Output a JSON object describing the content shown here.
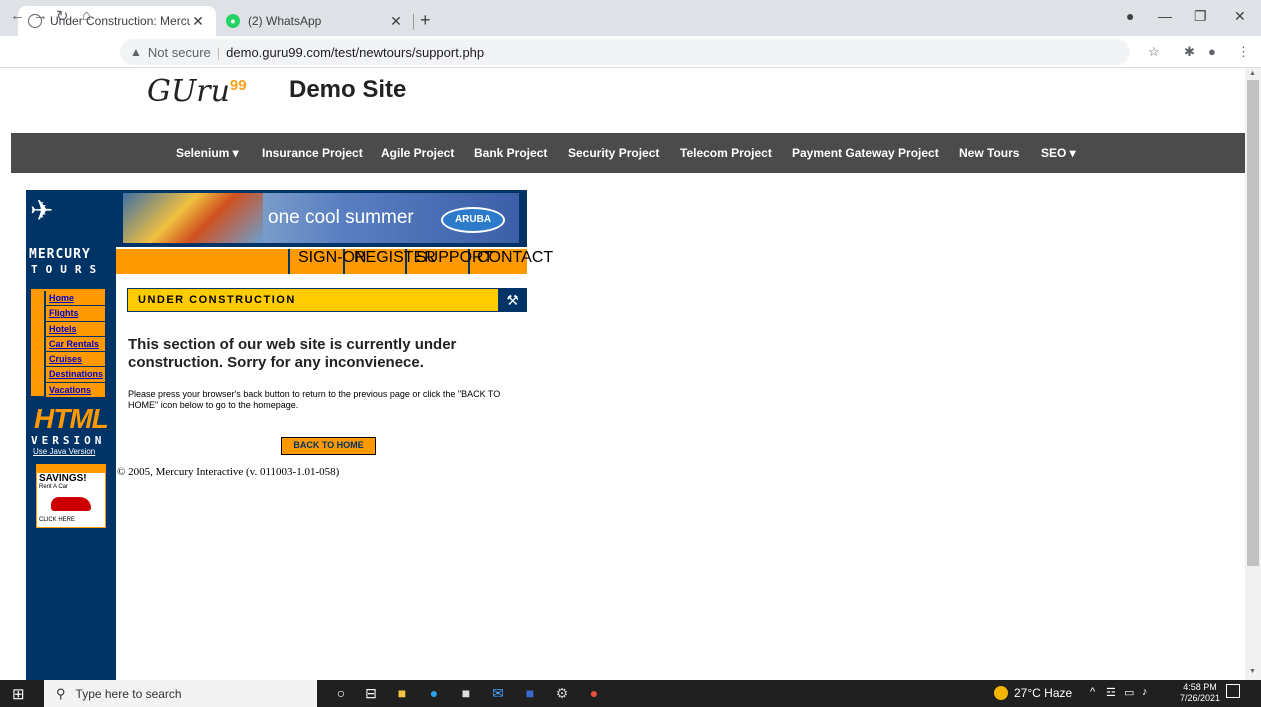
{
  "browser": {
    "tabs": [
      {
        "title": "Under Construction: Mercury Tou",
        "active": true
      },
      {
        "title": "(2) WhatsApp",
        "active": false
      }
    ],
    "new_tab": "+",
    "address": {
      "security": "Not secure",
      "url": "demo.guru99.com/test/newtours/support.php"
    }
  },
  "guru99": {
    "logo_text": "GUru",
    "logo_sup": "99",
    "title": "Demo Site",
    "nav": [
      "Selenium ▾",
      "Insurance Project",
      "Agile Project",
      "Bank Project",
      "Security Project",
      "Telecom Project",
      "Payment Gateway Project",
      "New Tours",
      "SEO ▾"
    ]
  },
  "mercury": {
    "logo_mercury": "MERCURY",
    "logo_tours": "TOURS",
    "banner_text": "one cool summer",
    "banner_brand": "ARUBA",
    "top_nav": [
      "SIGN-ON",
      "REGISTER",
      "SUPPORT",
      "CONTACT"
    ],
    "side_menu": [
      "Home",
      "Flights",
      "Hotels",
      "Car Rentals",
      "Cruises",
      "Destinations",
      "Vacations"
    ],
    "html_label": "HTML",
    "version_label": "VERSION",
    "java_link": "Use Java Version",
    "ad": {
      "headline": "SAVINGS!",
      "sub": "Rent A Car",
      "cta": "CLICK HERE"
    },
    "under_construction": "UNDER CONSTRUCTION",
    "heading": "This section of our web site is currently under construction.  Sorry for any inconvienece.",
    "body": "Please press your browser's back button to return to the previous page or click the \"BACK TO HOME\" icon below to go to the homepage.",
    "back_button": "BACK TO HOME",
    "copyright": "© 2005, Mercury Interactive (v. 011003-1.01-058)"
  },
  "taskbar": {
    "search_placeholder": "Type here to search",
    "weather": "27°C  Haze",
    "time": "4:58 PM",
    "date": "7/26/2021"
  },
  "colors": {
    "mercury_navy": "#003366",
    "mercury_orange": "#ff9900",
    "mercury_yellow": "#ffcc00",
    "guru_nav": "#4b4b4b",
    "guru_accent": "#f7a11a"
  }
}
